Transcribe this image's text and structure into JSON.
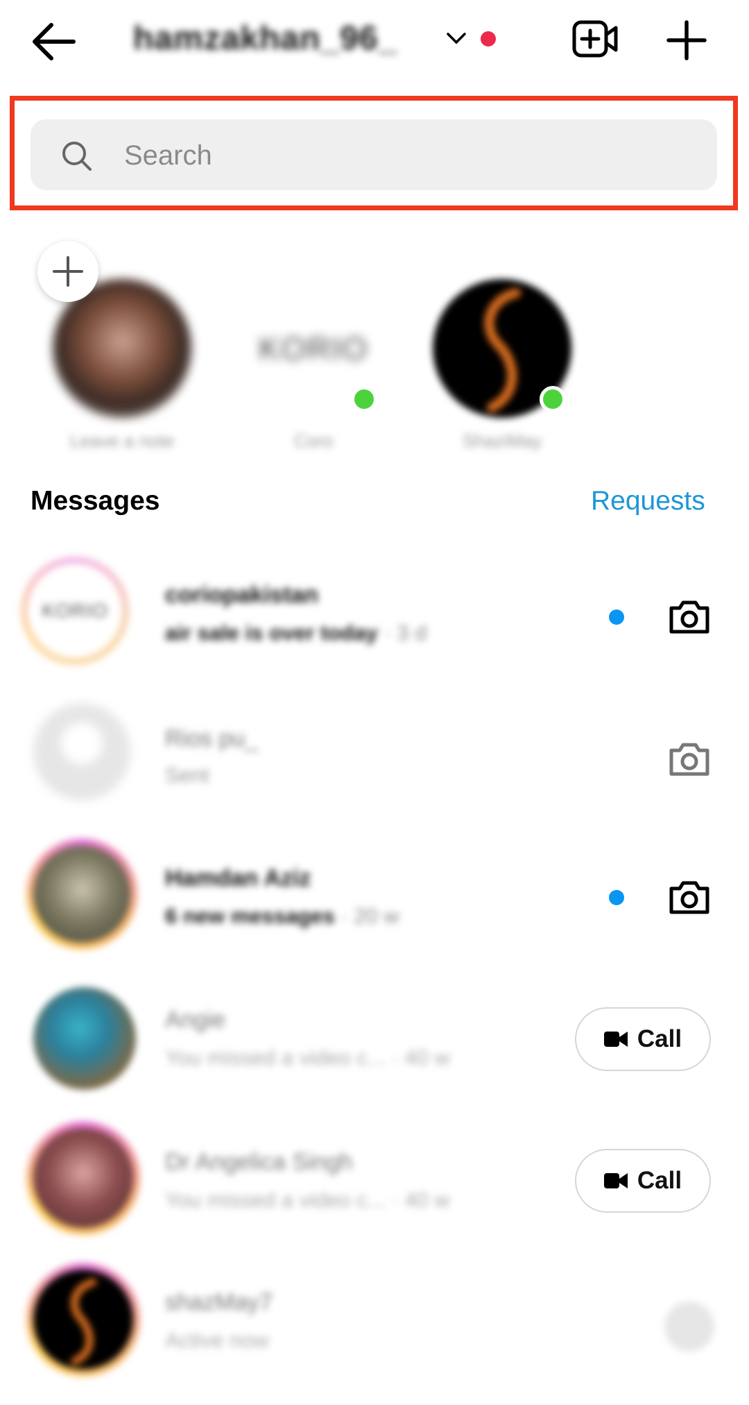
{
  "header": {
    "username": "hamzakhan_96_",
    "icons": [
      "back-arrow-icon",
      "chevron-down-icon",
      "new-video-icon",
      "plus-icon"
    ]
  },
  "search": {
    "placeholder": "Search"
  },
  "stories": [
    {
      "name": "Leave a note"
    },
    {
      "name": "Coro",
      "avatar_text": "KORIO"
    },
    {
      "name": "ShaziMay"
    }
  ],
  "messages_header": {
    "title": "Messages",
    "requests": "Requests"
  },
  "threads": [
    {
      "name": "coriopakistan",
      "preview": "air sale is over today",
      "time": "· 3 d",
      "action": "camera",
      "unread": true,
      "avatar_text": "KORIO"
    },
    {
      "name": "Rios pu_",
      "preview": "Sent",
      "time": "",
      "action": "camera",
      "unread": false
    },
    {
      "name": "Hamdan Aziz",
      "preview": "6 new messages",
      "time": "· 20 w",
      "action": "camera",
      "unread": true
    },
    {
      "name": "Angie",
      "preview": "You missed a video c...",
      "time": "· 40 w",
      "action": "call",
      "call_label": "Call"
    },
    {
      "name": "Dr Angelica Singh",
      "preview": "You missed a video c...",
      "time": "· 40 w",
      "action": "call",
      "call_label": "Call"
    },
    {
      "name": "shazMay7",
      "preview": "Active now",
      "time": "",
      "action": "none"
    }
  ],
  "colors": {
    "accent": "#1e95d6",
    "highlight": "#f0391e",
    "online": "#4cd33c",
    "unread": "#0a95f0"
  }
}
